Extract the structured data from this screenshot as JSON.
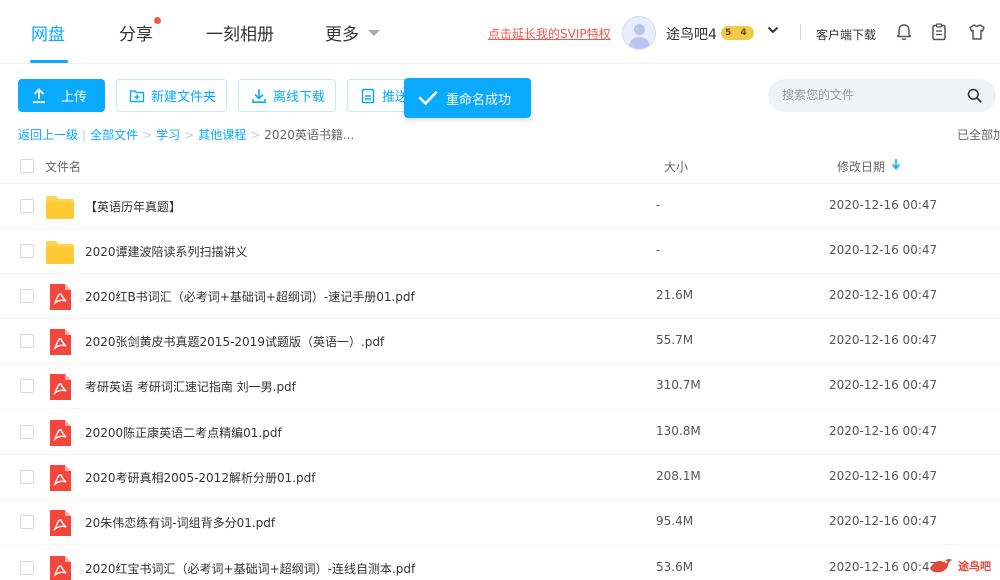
{
  "nav": {
    "items": [
      "网盘",
      "分享",
      "一刻相册",
      "更多"
    ],
    "active": "网盘"
  },
  "header": {
    "svip_link": "点击延长我的SVIP特权",
    "username": "途鸟吧4",
    "level_badge": "5 4",
    "client_download": "客户端下载",
    "icons": [
      "bell-icon",
      "clipboard-icon",
      "shirt-icon"
    ]
  },
  "toolbar": {
    "upload": "上传",
    "new_folder": "新建文件夹",
    "offline_download": "离线下载",
    "push": "推送",
    "toast": "重命名成功",
    "search_placeholder": "搜索您的文件"
  },
  "breadcrumb": {
    "back": "返回上一级",
    "items": [
      "全部文件",
      "学习",
      "其他课程",
      "2020英语书籍..."
    ],
    "loaded_all": "已全部加载"
  },
  "list": {
    "columns": {
      "name": "文件名",
      "size": "大小",
      "modified": "修改日期"
    },
    "rows": [
      {
        "type": "folder",
        "name": "【英语历年真题】",
        "size": "-",
        "modified": "2020-12-16 00:47"
      },
      {
        "type": "folder",
        "name": "2020谭建波陪读系列扫描讲义",
        "size": "-",
        "modified": "2020-12-16 00:47"
      },
      {
        "type": "pdf",
        "name": "2020红B书词汇（必考词+基础词+超纲词）-速记手册01.pdf",
        "size": "21.6M",
        "modified": "2020-12-16 00:47"
      },
      {
        "type": "pdf",
        "name": "2020张剑黄皮书真题2015-2019试题版（英语一）.pdf",
        "size": "55.7M",
        "modified": "2020-12-16 00:47"
      },
      {
        "type": "pdf",
        "name": "考研英语 考研词汇速记指南 刘一男.pdf",
        "size": "310.7M",
        "modified": "2020-12-16 00:47"
      },
      {
        "type": "pdf",
        "name": "20200陈正康英语二考点精编01.pdf",
        "size": "130.8M",
        "modified": "2020-12-16 00:47"
      },
      {
        "type": "pdf",
        "name": "2020考研真相2005-2012解析分册01.pdf",
        "size": "208.1M",
        "modified": "2020-12-16 00:47"
      },
      {
        "type": "pdf",
        "name": "20朱伟恋练有词-词组背多分01.pdf",
        "size": "95.4M",
        "modified": "2020-12-16 00:47"
      },
      {
        "type": "pdf",
        "name": "2020红宝书词汇（必考词+基础词+超纲词）-连线自测本.pdf",
        "size": "53.6M",
        "modified": "2020-12-16 00:47"
      }
    ]
  },
  "watermark": {
    "text": "途鸟吧"
  },
  "colors": {
    "accent": "#09aaff",
    "red": "#f5564a",
    "folder": "#ffd24d",
    "pdf": "#f4473c"
  }
}
